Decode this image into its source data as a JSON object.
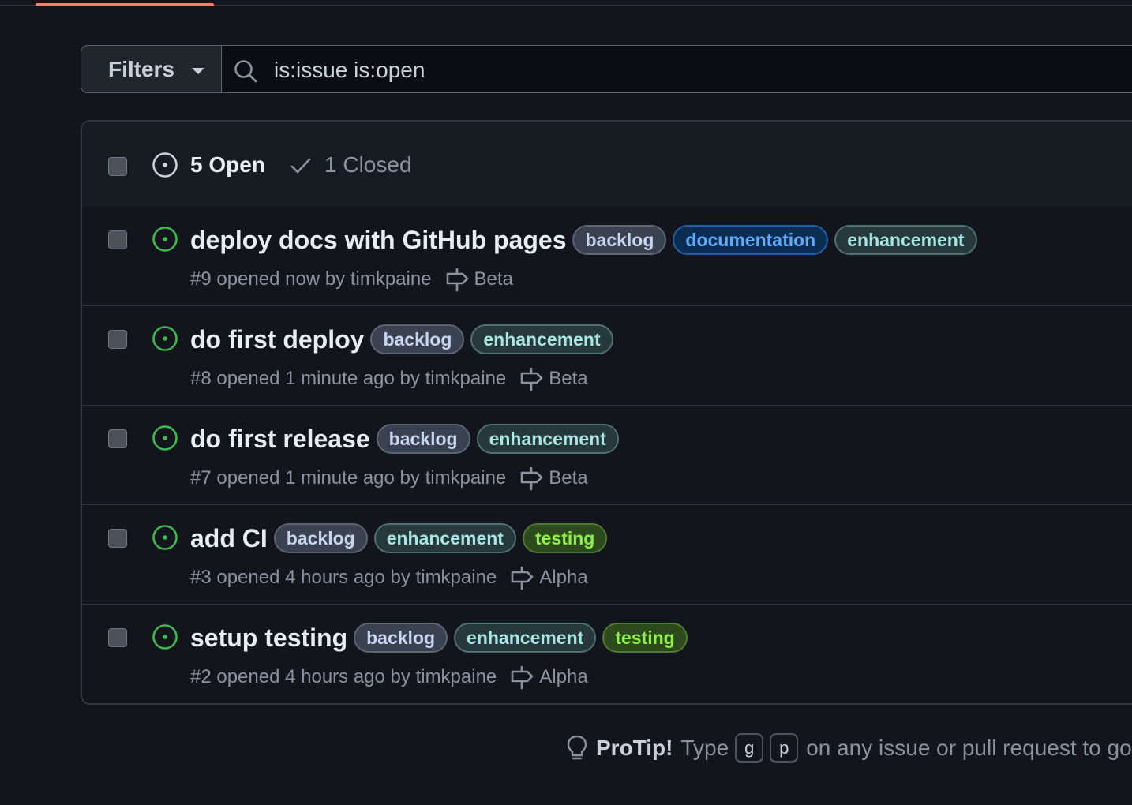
{
  "filters": {
    "label": "Filters"
  },
  "search": {
    "value": "is:issue is:open"
  },
  "header": {
    "open_label": "5 Open",
    "closed_label": "1 Closed"
  },
  "issues": [
    {
      "title": "deploy docs with GitHub pages",
      "labels": [
        "backlog",
        "documentation",
        "enhancement"
      ],
      "meta": "#9 opened now by timkpaine",
      "milestone": "Beta"
    },
    {
      "title": "do first deploy",
      "labels": [
        "backlog",
        "enhancement"
      ],
      "meta": "#8 opened 1 minute ago by timkpaine",
      "milestone": "Beta"
    },
    {
      "title": "do first release",
      "labels": [
        "backlog",
        "enhancement"
      ],
      "meta": "#7 opened 1 minute ago by timkpaine",
      "milestone": "Beta"
    },
    {
      "title": "add CI",
      "labels": [
        "backlog",
        "enhancement",
        "testing"
      ],
      "meta": "#3 opened 4 hours ago by timkpaine",
      "milestone": "Alpha"
    },
    {
      "title": "setup testing",
      "labels": [
        "backlog",
        "enhancement",
        "testing"
      ],
      "meta": "#2 opened 4 hours ago by timkpaine",
      "milestone": "Alpha"
    }
  ],
  "protip": {
    "strong": "ProTip!",
    "type_word": "Type",
    "key1": "g",
    "key2": "p",
    "text": "on any issue or pull request to go"
  },
  "colors": {
    "open_icon": "#3fb950",
    "accent_underline": "#f78166",
    "background": "#12161c"
  },
  "icons": {
    "search": "search-icon",
    "issue_open": "issue-opened-icon",
    "check": "check-icon",
    "milestone": "milestone-icon",
    "bulb": "light-bulb-icon"
  }
}
